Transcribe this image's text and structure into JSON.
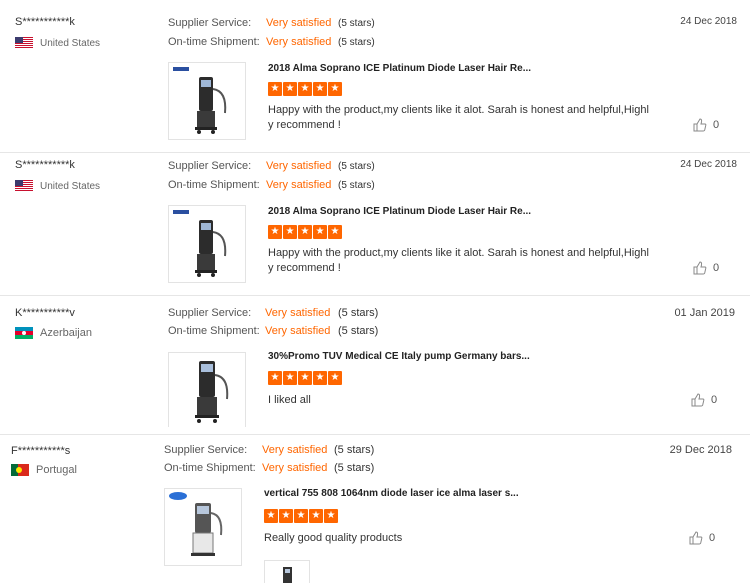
{
  "colors": {
    "accent": "#ff6600",
    "divider": "#e6e6e6"
  },
  "reviews": [
    {
      "buyer": "S***********k",
      "country": "United States",
      "flag": "us-flag-icon",
      "supplier_label": "Supplier Service:",
      "supplier_value": "Very satisfied",
      "supplier_stars": "(5 stars)",
      "shipment_label": "On-time Shipment:",
      "shipment_value": "Very satisfied",
      "shipment_stars": "(5 stars)",
      "date": "24 Dec 2018",
      "product": "2018 Alma Soprano ICE Platinum Diode Laser Hair Re...",
      "rating": 5,
      "comment": "Happy with the product,my clients like it alot. Sarah is honest and helpful,Highl y recommend !",
      "helpful": "0"
    },
    {
      "buyer": "S***********k",
      "country": "United States",
      "flag": "us-flag-icon",
      "supplier_label": "Supplier Service:",
      "supplier_value": "Very satisfied",
      "supplier_stars": "(5 stars)",
      "shipment_label": "On-time Shipment:",
      "shipment_value": "Very satisfied",
      "shipment_stars": "(5 stars)",
      "date": "24 Dec 2018",
      "product": "2018 Alma Soprano ICE Platinum Diode Laser Hair Re...",
      "rating": 5,
      "comment": "Happy with the product,my clients like it alot. Sarah is honest and helpful,Highl y recommend !",
      "helpful": "0"
    },
    {
      "buyer": "K***********v",
      "country": "Azerbaijan",
      "flag": "azerbaijan-flag-icon",
      "supplier_label": "Supplier Service:",
      "supplier_value": "Very satisfied",
      "supplier_stars": "(5 stars)",
      "shipment_label": "On-time Shipment:",
      "shipment_value": "Very satisfied",
      "shipment_stars": "(5 stars)",
      "date": "01 Jan 2019",
      "product": "30%Promo TUV Medical CE Italy pump Germany bars...",
      "rating": 5,
      "comment": "I liked all",
      "helpful": "0"
    },
    {
      "buyer": "F***********s",
      "country": "Portugal",
      "flag": "portugal-flag-icon",
      "supplier_label": "Supplier Service:",
      "supplier_value": "Very satisfied",
      "supplier_stars": "(5 stars)",
      "shipment_label": "On-time Shipment:",
      "shipment_value": "Very satisfied",
      "shipment_stars": "(5 stars)",
      "date": "29 Dec 2018",
      "product": "vertical 755 808 1064nm diode laser ice alma laser s...",
      "rating": 5,
      "comment": "Really good quality products",
      "helpful": "0"
    }
  ]
}
